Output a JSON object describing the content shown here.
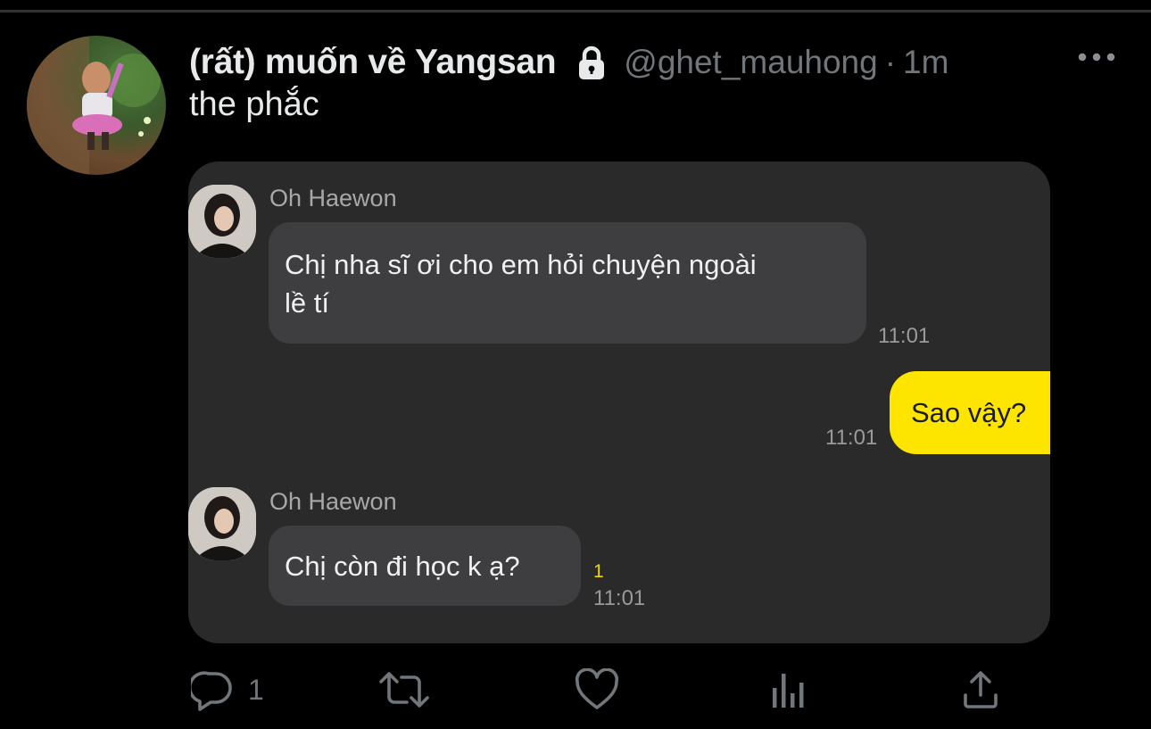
{
  "tweet": {
    "display_name": "(rất) muốn về Yangsan",
    "handle": "@ghet_mauhong",
    "separator": "·",
    "time": "1m",
    "text": "the phắc",
    "icons": {
      "protected": "lock-icon",
      "more": "more-icon"
    }
  },
  "chat": {
    "messages": [
      {
        "sender": "Oh Haewon",
        "text_line1": "Chị nha sĩ ơi cho em hỏi chuyện ngoài",
        "text_line2": "lề tí",
        "time": "11:01",
        "direction": "incoming"
      },
      {
        "text": "Sao vậy?",
        "time": "11:01",
        "direction": "outgoing"
      },
      {
        "sender": "Oh Haewon",
        "text": "Chị còn đi học k ạ?",
        "unread": "1",
        "time": "11:01",
        "direction": "incoming"
      }
    ],
    "colors": {
      "background": "#2a2a2b",
      "incoming_bubble": "#3e3e40",
      "outgoing_bubble": "#fee500",
      "unread": "#f1d60e"
    }
  },
  "actions": {
    "reply_count": "1",
    "icons": [
      "reply-icon",
      "retweet-icon",
      "like-icon",
      "views-icon",
      "share-icon"
    ]
  },
  "colors": {
    "background": "#000000",
    "text": "#e7e9ea",
    "secondary": "#71767b"
  }
}
